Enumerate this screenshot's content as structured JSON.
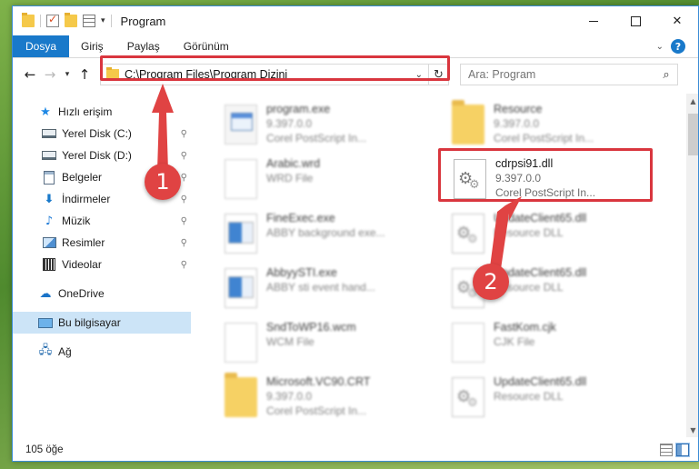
{
  "window": {
    "title": "Program",
    "close_glyph": "✕"
  },
  "ribbon": {
    "tabs": [
      "Dosya",
      "Giriş",
      "Paylaş",
      "Görünüm"
    ]
  },
  "nav": {
    "back_glyph": "←",
    "forward_glyph": "→",
    "recent_glyph": "▾",
    "up_glyph": "↑",
    "address_path": "C:\\Program Files\\Program Dizini",
    "address_dropdown_glyph": "⌄",
    "refresh_glyph": "↻",
    "search_placeholder": "Ara: Program",
    "search_glyph": "⌕"
  },
  "sidebar": {
    "items": [
      {
        "label": "Hızlı erişim",
        "icon": "star-icon",
        "pinned": false
      },
      {
        "label": "Yerel Disk (C:)",
        "icon": "drive-icon",
        "pinned": true
      },
      {
        "label": "Yerel Disk (D:)",
        "icon": "drive-icon",
        "pinned": true
      },
      {
        "label": "Belgeler",
        "icon": "documents-icon",
        "pinned": true
      },
      {
        "label": "İndirmeler",
        "icon": "downloads-icon",
        "pinned": true
      },
      {
        "label": "Müzik",
        "icon": "music-icon",
        "pinned": true
      },
      {
        "label": "Resimler",
        "icon": "pictures-icon",
        "pinned": true
      },
      {
        "label": "Videolar",
        "icon": "videos-icon",
        "pinned": true
      },
      {
        "label": "OneDrive",
        "icon": "onedrive-icon",
        "pinned": false
      },
      {
        "label": "Bu bilgisayar",
        "icon": "this-pc-icon",
        "pinned": false,
        "selected": true
      },
      {
        "label": "Ağ",
        "icon": "network-icon",
        "pinned": false
      }
    ],
    "pin_glyph": "📌"
  },
  "files": {
    "left": [
      {
        "name": "program.exe",
        "meta1": "9.397.0.0",
        "meta2": "Corel PostScript In...",
        "icon": "exe-icon"
      },
      {
        "name": "Arabic.wrd",
        "meta1": "WRD File",
        "meta2": "",
        "icon": "document-icon"
      },
      {
        "name": "FineExec.exe",
        "meta1": "ABBY background exe...",
        "meta2": "",
        "icon": "app-icon"
      },
      {
        "name": "AbbyySTI.exe",
        "meta1": "ABBY sti event hand...",
        "meta2": "",
        "icon": "app-icon"
      },
      {
        "name": "SndToWP16.wcm",
        "meta1": "WCM File",
        "meta2": "",
        "icon": "document-icon"
      },
      {
        "name": "Microsoft.VC90.CRT",
        "meta1": "9.397.0.0",
        "meta2": "Corel PostScript In...",
        "icon": "folder-icon"
      }
    ],
    "right": [
      {
        "name": "Resource",
        "meta1": "9.397.0.0",
        "meta2": "Corel PostScript In...",
        "icon": "folder-icon"
      },
      {
        "name": "cdrpsi91.dll",
        "meta1": "9.397.0.0",
        "meta2": "Corel PostScript In...",
        "icon": "dll-icon",
        "highlighted": true
      },
      {
        "name": "UpdateClient65.dll",
        "meta1": "Resource DLL",
        "meta2": "",
        "icon": "dll-icon"
      },
      {
        "name": "UpdateClient65.dll",
        "meta1": "Resource DLL",
        "meta2": "",
        "icon": "dll-icon"
      },
      {
        "name": "FastKom.cjk",
        "meta1": "CJK File",
        "meta2": "",
        "icon": "document-icon"
      },
      {
        "name": "UpdateClient65.dll",
        "meta1": "Resource DLL",
        "meta2": "",
        "icon": "dll-icon"
      }
    ]
  },
  "status": {
    "item_count": "105 öğe"
  },
  "annotations": {
    "step1": "1",
    "step2": "2",
    "color": "#e04343"
  }
}
